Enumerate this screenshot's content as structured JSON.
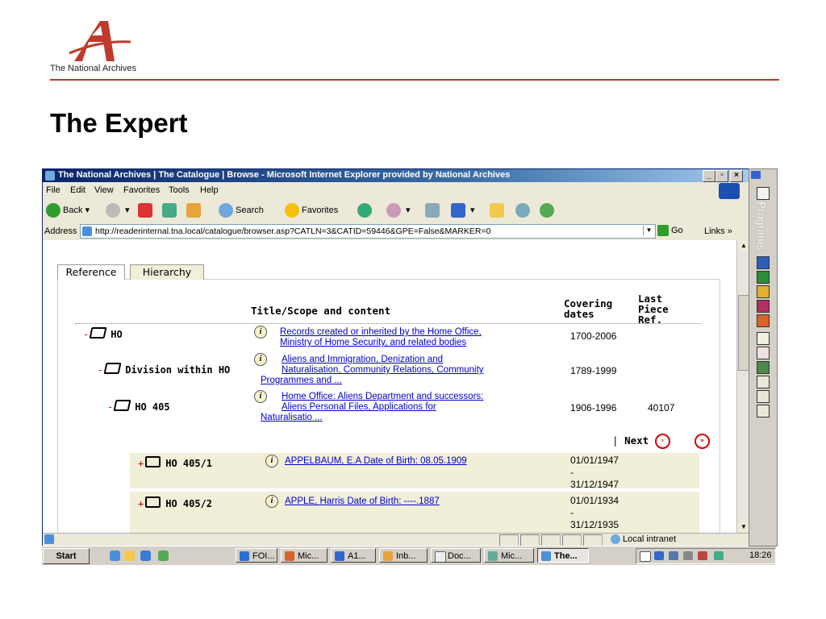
{
  "slide": {
    "organisation": "The National Archives",
    "title": "The Expert",
    "logo_letter": "A",
    "brand_color": "#c0392b"
  },
  "window": {
    "title": "The National Archives | The Catalogue | Browse - Microsoft Internet Explorer provided by National Archives",
    "controls": [
      "_",
      "▫",
      "×"
    ]
  },
  "menu": [
    "File",
    "Edit",
    "View",
    "Favorites",
    "Tools",
    "Help"
  ],
  "toolbar": {
    "back": "Back",
    "search": "Search",
    "favorites": "Favorites"
  },
  "address": {
    "label": "Address",
    "url": "http://readerinternal.tna.local/catalogue/browser.asp?CATLN=3&CATID=59446&GPE=False&MARKER=0",
    "go": "Go",
    "links": "Links »"
  },
  "tabs": {
    "reference": "Reference",
    "hierarchy": "Hierarchy"
  },
  "table": {
    "headers": {
      "title": "Title/Scope and content",
      "covering": "Covering dates",
      "last_piece": "Last Piece Ref."
    },
    "hierarchy": [
      {
        "sign": "-",
        "name": "HO",
        "desc_line1": "Records created or inherited by the Home Office,",
        "desc_line2": "Ministry of Home Security, and related bodies",
        "desc_line3": "",
        "dates": "1700-2006",
        "last": ""
      },
      {
        "sign": "-",
        "name": "Division within HO",
        "desc_line1": "Aliens and Immigration, Denization and",
        "desc_line2": "Naturalisation, Community Relations, Community",
        "desc_line3": "Programmes and ...",
        "dates": "1789-1999",
        "last": ""
      },
      {
        "sign": "-",
        "name": "HO 405",
        "desc_line1": "Home Office: Aliens Department and successors:",
        "desc_line2": "Aliens Personal Files, Applications for",
        "desc_line3": "Naturalisatio ...",
        "dates": "1906-1996",
        "last": "40107"
      }
    ],
    "pager": {
      "separator": "|",
      "next": "Next"
    },
    "children": [
      {
        "sign": "+",
        "name": "HO 405/1",
        "desc": "APPELBAUM, E.A Date of Birth: 08.05.1909",
        "date_from": "01/01/1947",
        "dash": "-",
        "date_to": "31/12/1947"
      },
      {
        "sign": "+",
        "name": "HO 405/2",
        "desc": "APPLE, Harris Date of Birth: ----.1887",
        "date_from": "01/01/1934",
        "dash": "-",
        "date_to": "31/12/1935"
      }
    ]
  },
  "status": {
    "zone": "Local intranet"
  },
  "taskbar": {
    "start": "Start",
    "tasks": [
      "FOI...",
      "Mic...",
      "A1...",
      "Inb...",
      "Doc...",
      "Mic...",
      "The..."
    ],
    "clock": "18:26"
  },
  "sidebar": {
    "label": "Programs"
  }
}
